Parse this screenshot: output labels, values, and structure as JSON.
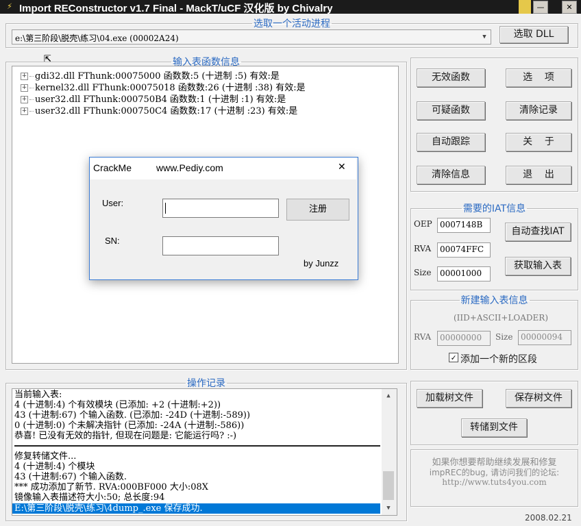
{
  "window": {
    "title": "Import REConstructor v1.7 Final - MackT/uCF 汉化版 by Chivalry",
    "minimize": "—",
    "close": "✕"
  },
  "process_group": {
    "legend": "选取一个活动进程",
    "selected_process": "e:\\第三阶段\\脱壳\\练习\\04.exe (00002A24)",
    "pick_dll_button": "选取 DLL"
  },
  "imports_group": {
    "legend": "输入表函数信息",
    "tree": [
      {
        "text": "gdi32.dll FThunk:00075000 函数数:5 (十进制 :5) 有效:是"
      },
      {
        "text": "kernel32.dll FThunk:00075018 函数数:26 (十进制 :38) 有效:是"
      },
      {
        "text": "user32.dll FThunk:000750B4 函数数:1 (十进制 :1) 有效:是"
      },
      {
        "text": "user32.dll FThunk:000750C4 函数数:17 (十进制 :23) 有效:是"
      }
    ]
  },
  "actions_left": {
    "invalid_funcs": "无效函数",
    "suspect_funcs": "可疑函数",
    "auto_trace": "自动跟踪",
    "clear_info": "清除信息"
  },
  "actions_right": {
    "options": "选    项",
    "clear_log": "清除记录",
    "about": "关    于",
    "exit": "退    出"
  },
  "iat_group": {
    "legend": "需要的IAT信息",
    "oep_label": "OEP",
    "oep_value": "0007148B",
    "rva_label": "RVA",
    "rva_value": "00074FFC",
    "size_label": "Size",
    "size_value": "00001000",
    "auto_find_button": "自动查找IAT",
    "get_imports_button": "获取输入表"
  },
  "new_import_group": {
    "legend": "新建输入表信息",
    "formula": "(IID+ASCII+LOADER)",
    "rva_label": "RVA",
    "rva_value": "00000000",
    "size_label": "Size",
    "size_value": "00000094",
    "checkbox_label": "添加一个新的区段",
    "checkbox_checked": true
  },
  "log_group": {
    "legend": "操作记录",
    "lines_top": [
      "当前输入表:",
      "4 (十进制:4) 个有效模块 (已添加: +2 (十进制:+2))",
      "43 (十进制:67) 个输入函数. (已添加: -24D (十进制:-589))",
      "0 (十进制:0) 个未解决指针 (已添加: -24A (十进制:-586))",
      "恭喜! 已没有无效的指针, 但现在问题是: 它能运行吗? :-)"
    ],
    "lines_bottom": [
      "修复转储文件...",
      "4 (十进制:4) 个模块",
      "43 (十进制:67) 个输入函数.",
      "*** 成功添加了新节. RVA:000BF000 大小:08X",
      "镜像输入表描述符大小:50; 总长度:94"
    ],
    "selected_line": "E:\\第三阶段\\脱壳\\练习\\4dump_.exe 保存成功."
  },
  "tree_buttons": {
    "load_tree": "加载树文件",
    "save_tree": "保存树文件",
    "dump_to_file": "转储到文件"
  },
  "info_panel": {
    "line1": "如果你想要帮助继续发展和修复",
    "line2": "impREC的bug, 请访问我们的论坛:",
    "url": "http://www.tuts4you.com"
  },
  "date": "2008.02.21",
  "dialog": {
    "title": "CrackMe",
    "site": "www.Pediy.com",
    "close": "✕",
    "user_label": "User:",
    "user_value": "",
    "sn_label": "SN:",
    "sn_value": "",
    "register_button": "注册",
    "author": "by Junzz"
  },
  "colors": {
    "accent": "#2b6ac2",
    "selection": "#0078d7",
    "titlebar": "#1b1b1b"
  }
}
